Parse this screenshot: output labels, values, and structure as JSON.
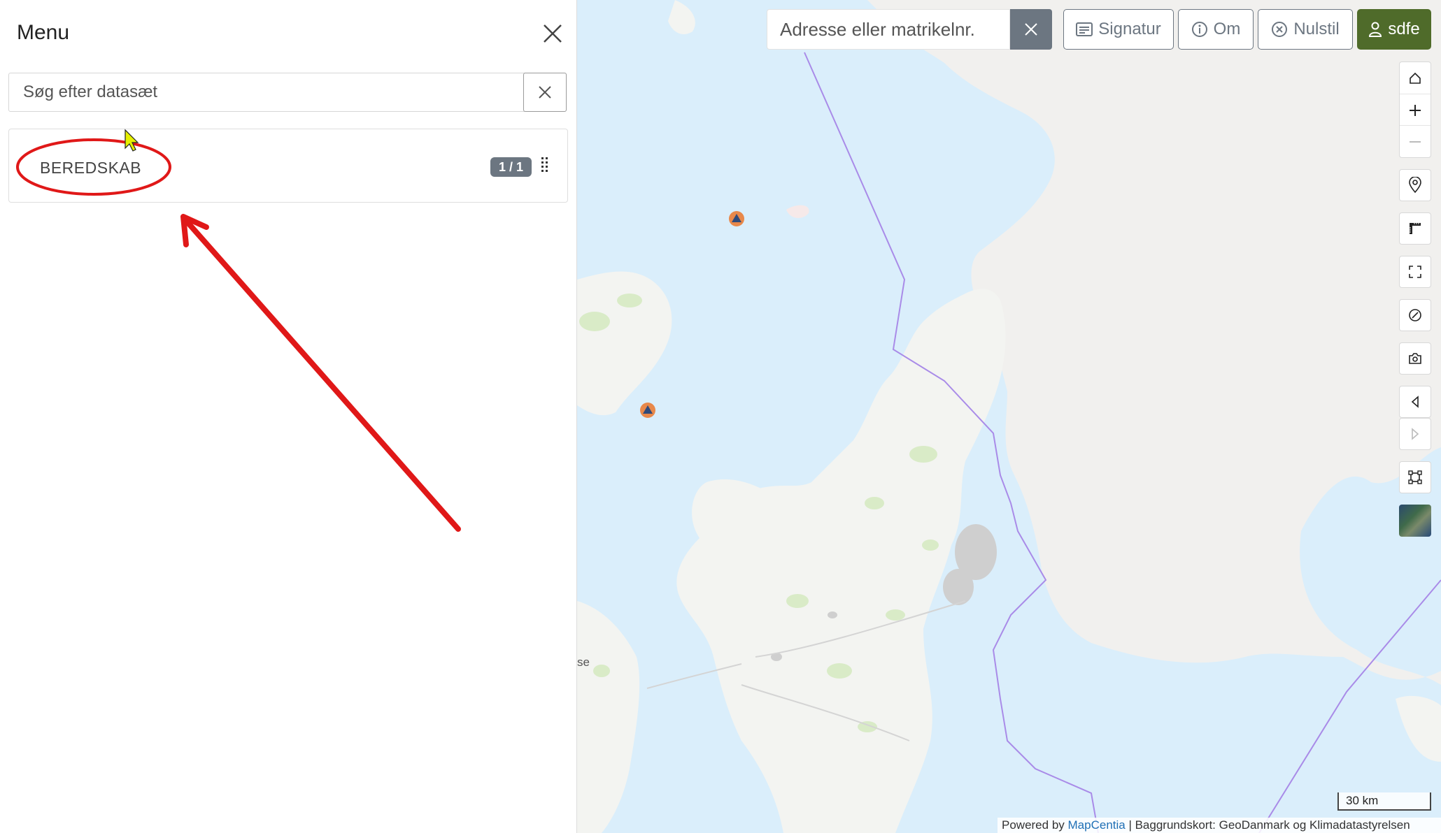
{
  "menu": {
    "title": "Menu",
    "search_placeholder": "Søg efter datasæt",
    "datasets": [
      {
        "label": "BEREDSKAB",
        "badge": "1 / 1"
      }
    ]
  },
  "map": {
    "address_placeholder": "Adresse eller matrikelnr.",
    "toolbar": {
      "signatur": "Signatur",
      "om": "Om",
      "nulstil": "Nulstil",
      "user": "sdfe"
    },
    "map_labels": {
      "partial_place": "se"
    },
    "scale_label": "30 km",
    "attribution": {
      "powered_by": "Powered by",
      "link_text": "MapCentia",
      "rest": " | Baggrundskort: GeoDanmark og Klimadatastyrelsen"
    }
  },
  "colors": {
    "water": "#daeefb",
    "land": "#f2f2f2",
    "sweden_land": "#f1f0ee",
    "border_line": "#a98be8",
    "annotation_red": "#e01818",
    "badge_bg": "#6c7681",
    "user_btn_bg": "#4f6b2a",
    "marker_orange": "#e8884a",
    "marker_blue": "#2f4a7a"
  },
  "icons": {
    "close": "close-icon",
    "search_clear": "close-icon",
    "signatur": "list-icon",
    "om": "info-icon",
    "nulstil": "x-circle-icon",
    "user": "person-icon",
    "controls": [
      "home-icon",
      "plus-icon",
      "minus-icon",
      "location-pin-icon",
      "measure-icon",
      "fullscreen-icon",
      "no-entry-icon",
      "camera-icon",
      "back-arrow-icon",
      "forward-arrow-icon",
      "extent-icon",
      "satellite-thumbnail"
    ]
  }
}
